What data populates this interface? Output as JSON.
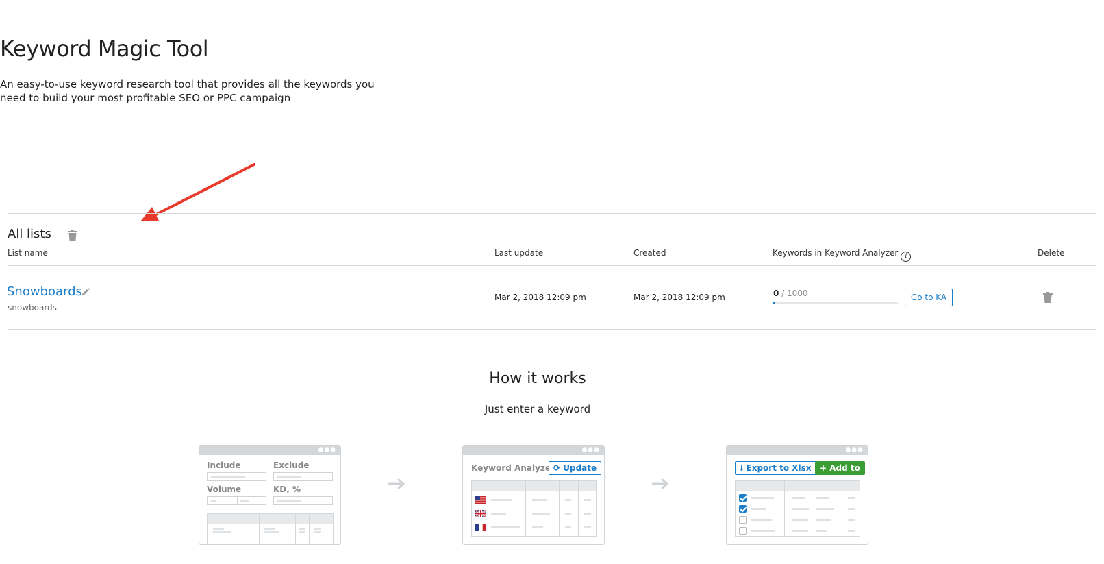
{
  "header": {
    "title": "Keyword Magic Tool",
    "subtitle_line1": "An easy-to-use keyword research tool that provides all the keywords you",
    "subtitle_line2": "need to build your most profitable SEO or PPC campaign"
  },
  "lists": {
    "title": "All lists",
    "columns": {
      "list_name": "List name",
      "last_update": "Last update",
      "created": "Created",
      "keywords_in_ka": "Keywords in Keyword Analyzer",
      "delete": "Delete"
    },
    "rows": [
      {
        "name": "Snowboards",
        "seed": "snowboards",
        "last_update": "Mar 2, 2018 12:09 pm",
        "created": "Mar 2, 2018 12:09 pm",
        "ka_count": "0",
        "ka_limit": "1000",
        "ka_fraction": 0.0,
        "go_button": "Go to KA"
      }
    ]
  },
  "how": {
    "title": "How it works",
    "subtitle": "Just enter a keyword",
    "card1": {
      "include": "Include",
      "exclude": "Exclude",
      "volume": "Volume",
      "kd": "KD, %"
    },
    "card2": {
      "title": "Keyword Analyzer",
      "update": "Update"
    },
    "card3": {
      "export": "Export to Xlsx",
      "add": "Add to"
    }
  },
  "colors": {
    "link": "#1a7ecb",
    "annotation_arrow": "#e8392b",
    "green": "#3a9e34"
  },
  "icons": [
    "trash-icon",
    "pencil-icon",
    "info-icon",
    "refresh-icon",
    "download-icon",
    "plus-icon",
    "arrow-right-icon",
    "checkbox-icon"
  ]
}
